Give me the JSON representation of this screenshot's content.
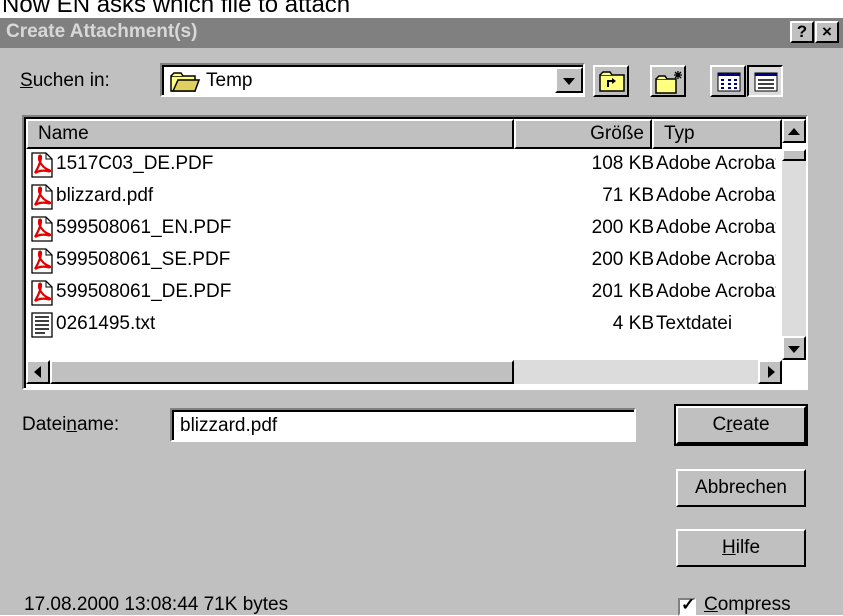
{
  "caption": "Now EN asks which file to attach",
  "window": {
    "title": "Create Attachment(s)",
    "help_btn": "?",
    "close_btn": "×"
  },
  "look_in": {
    "label_pre": "",
    "label_u": "S",
    "label_post": "uchen in:",
    "value": "Temp"
  },
  "toolbar": {
    "icons": [
      "up-folder-icon",
      "new-folder-icon",
      "list-view-icon",
      "details-view-icon"
    ]
  },
  "columns": {
    "name": "Name",
    "size": "Größe",
    "type": "Typ"
  },
  "files": [
    {
      "name": "1517C03_DE.PDF",
      "size": "108 KB",
      "type": "Adobe Acrobat-Dokument",
      "icon": "pdf-file-icon"
    },
    {
      "name": "blizzard.pdf",
      "size": "71 KB",
      "type": "Adobe Acrobat-Dokument",
      "icon": "pdf-file-icon"
    },
    {
      "name": "599508061_EN.PDF",
      "size": "200 KB",
      "type": "Adobe Acrobat-Dokument",
      "icon": "pdf-file-icon"
    },
    {
      "name": "599508061_SE.PDF",
      "size": "200 KB",
      "type": "Adobe Acrobat-Dokument",
      "icon": "pdf-file-icon"
    },
    {
      "name": "599508061_DE.PDF",
      "size": "201 KB",
      "type": "Adobe Acrobat-Dokument",
      "icon": "pdf-file-icon"
    },
    {
      "name": "0261495.txt",
      "size": "4 KB",
      "type": "Textdatei",
      "icon": "text-file-icon"
    }
  ],
  "filename": {
    "label_pre": "Datei",
    "label_u": "n",
    "label_post": "ame:",
    "value": "blizzard.pdf"
  },
  "buttons": {
    "create": {
      "pre": "C",
      "u": "r",
      "post": "eate"
    },
    "cancel": "Abbrechen",
    "help": {
      "pre": "",
      "u": "H",
      "post": "ilfe"
    }
  },
  "status": "17.08.2000 13:08:44 71K bytes",
  "compress": {
    "u": "C",
    "post": "ompress",
    "checked": true
  }
}
